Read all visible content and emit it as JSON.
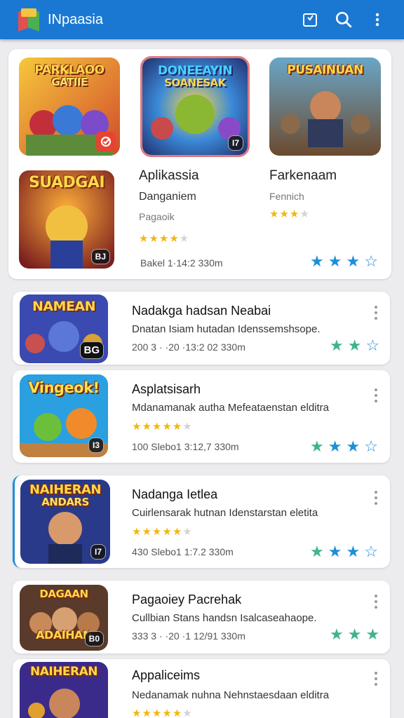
{
  "appbar": {
    "title": "INpaasia",
    "icons": [
      "app-logo-icon",
      "bookmark-icon",
      "search-icon",
      "more-vert-icon"
    ],
    "color": "#1a78d2"
  },
  "featured": {
    "tiles": [
      {
        "title": "PARKLAOO",
        "title2": "GATIIE",
        "badge": ""
      },
      {
        "title": "DONEEAYIN",
        "title2": "SOANESAK",
        "badge": "I7"
      },
      {
        "title": "PUSAINUAN",
        "title2": "",
        "badge": ""
      },
      {
        "title": "SUADGAI",
        "title2": "",
        "badge": "BJ"
      }
    ],
    "col1": {
      "name": "Aplikassia",
      "sub": "Danganiem",
      "sub2": "Pagaoik",
      "rating": 4,
      "meta": "Bakel 1·14:2 330m"
    },
    "col2": {
      "name": "Farkenaam",
      "sub2": "Fennich",
      "rating": 3
    },
    "right_stars": [
      "#1d8fd8",
      "#1d8fd8",
      "#1d8fd8",
      "outline"
    ]
  },
  "list": [
    {
      "tile": "NAMEAN",
      "tile2": "",
      "badge": "BG",
      "title": "Nadakga hadsan Neabai",
      "desc": "Dnatan Isiam hutadan Idenssemshsope.",
      "meta": "200 3 · ·20 ·13:2 02 330m",
      "gold": 0,
      "stars": [
        "green",
        "green",
        "outline"
      ]
    },
    {
      "tile": "Vingeok!",
      "tile2": "",
      "badge": "I3",
      "title": "Asplatsisarh",
      "desc": "Mdanamanak autha Mefeataenstan elditra",
      "meta": "100 Slebo1 3:12,7 330m",
      "gold": 5,
      "stars": [
        "green",
        "blue",
        "blue",
        "outline"
      ]
    },
    {
      "tile": "NAIHERAN",
      "tile2": "ANDARS",
      "badge": "I7",
      "title": "Nadanga Ietlea",
      "desc": "Cuirlensarak hutnan Idenstarstan eletita",
      "meta": "430 Slebo1 1:7.2 330m",
      "gold": 5,
      "stars": [
        "green",
        "blue",
        "blue",
        "outline"
      ]
    },
    {
      "tile": "DAGAAN",
      "tile2": "ADAIHAN",
      "badge": "B0",
      "title": "Pagaoiey Pacrehak",
      "desc": "Cullbian Stans handsn Isalcaseahaope.",
      "meta": "333 3 · ·20 ·1 12/91 330m",
      "gold": 0,
      "stars": [
        "green",
        "green",
        "green"
      ]
    },
    {
      "tile": "NAIHERAN",
      "tile2": "",
      "badge": "",
      "title": "Appaliceims",
      "desc": "Nedanamak nuhna Nehnstaesdaan elditra",
      "meta": "",
      "gold": 5,
      "stars": [
        "green",
        "blue",
        "blue",
        "outline"
      ]
    }
  ],
  "colors": {
    "green": "#3fb48a",
    "blue": "#1d8fd8",
    "outline": "#2a8cd6",
    "gold": "#f2b70f"
  }
}
